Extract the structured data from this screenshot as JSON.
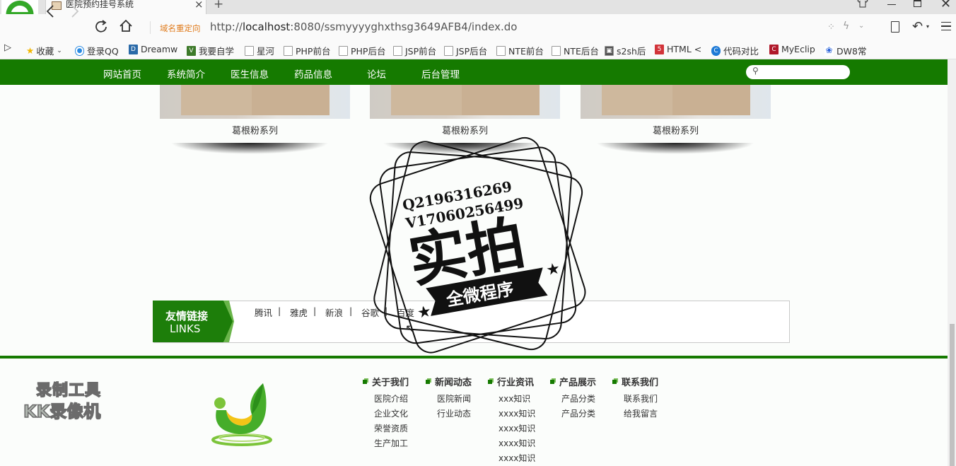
{
  "browser": {
    "tab_title": "医院预约挂号系统",
    "close_label": "×",
    "new_tab_label": "+",
    "redirect_label": "域名重定向",
    "url_prefix": "http://",
    "url_host": "localhost",
    "url_rest": ":8080/ssmyyyyghxthsg3649AFB4/index.do",
    "bookmarks": [
      "收藏",
      "登录QQ",
      "Dreamw",
      "我要自学",
      "星河",
      "PHP前台",
      "PHP后台",
      "JSP前台",
      "JSP后台",
      "NTE前台",
      "NTE后台",
      "s2sh后",
      "HTML <",
      "代码对比",
      "MyEclip",
      "DW8常"
    ]
  },
  "nav": {
    "items": [
      "网站首页",
      "系统简介",
      "医生信息",
      "药品信息",
      "论坛",
      "后台管理"
    ]
  },
  "products": [
    {
      "caption": "葛根粉系列"
    },
    {
      "caption": "葛根粉系列"
    },
    {
      "caption": "葛根粉系列"
    }
  ],
  "links": {
    "title_cn": "友情链接",
    "title_en": "LINKS",
    "items": [
      "腾讯",
      "雅虎",
      "新浪",
      "谷歌",
      "百度"
    ],
    "separator": "|"
  },
  "footer": {
    "columns": [
      {
        "title": "关于我们",
        "items": [
          "医院介绍",
          "企业文化",
          "荣誉资质",
          "生产加工"
        ]
      },
      {
        "title": "新闻动态",
        "items": [
          "医院新闻",
          "行业动态"
        ]
      },
      {
        "title": "行业资讯",
        "items": [
          "xxx知识",
          "xxxx知识",
          "xxxx知识",
          "xxxx知识",
          "xxxx知识"
        ]
      },
      {
        "title": "产品展示",
        "items": [
          "产品分类",
          "产品分类"
        ]
      },
      {
        "title": "联系我们",
        "items": [
          "联系我们",
          "给我留言"
        ]
      }
    ]
  },
  "watermarks": {
    "stamp_line1": "Q2196316269",
    "stamp_line2": "V17060256499",
    "stamp_main": "实拍",
    "stamp_ribbon": "全微程序",
    "recorder_line1": "录制工具",
    "recorder_line2": "KK录像机"
  },
  "colors": {
    "brand_green": "#157a00",
    "redirect_orange": "#e07c1e"
  }
}
